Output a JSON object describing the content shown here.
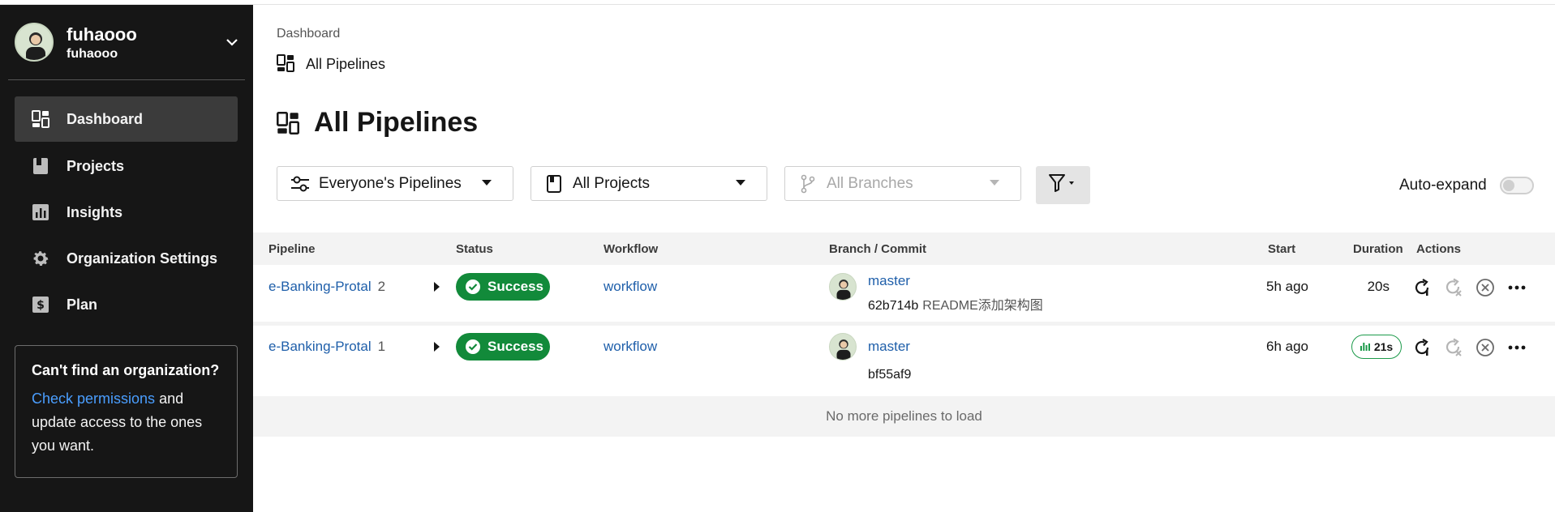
{
  "user": {
    "name": "fuhaooo",
    "org": "fuhaooo"
  },
  "nav": {
    "items": [
      {
        "label": "Dashboard",
        "icon": "dashboard-icon",
        "active": true
      },
      {
        "label": "Projects",
        "icon": "book-icon",
        "active": false
      },
      {
        "label": "Insights",
        "icon": "chart-icon",
        "active": false
      },
      {
        "label": "Organization Settings",
        "icon": "gear-icon",
        "active": false
      },
      {
        "label": "Plan",
        "icon": "dollar-icon",
        "active": false
      }
    ]
  },
  "orgbox": {
    "title": "Can't find an organization?",
    "link": "Check permissions",
    "text_after": " and update access to the ones you want."
  },
  "breadcrumb": {
    "parent": "Dashboard",
    "current": "All Pipelines"
  },
  "page_title": "All Pipelines",
  "filters": {
    "pipelines": "Everyone's Pipelines",
    "projects": "All Projects",
    "branches": "All Branches",
    "auto_expand": "Auto-expand"
  },
  "table": {
    "headers": {
      "pipeline": "Pipeline",
      "status": "Status",
      "workflow": "Workflow",
      "branch": "Branch / Commit",
      "start": "Start",
      "duration": "Duration",
      "actions": "Actions"
    },
    "rows": [
      {
        "pipeline": "e-Banking-Protal",
        "number": "2",
        "status": "Success",
        "workflow": "workflow",
        "branch": "master",
        "sha": "62b714b",
        "message": "README添加架构图",
        "start": "5h ago",
        "duration": "20s"
      },
      {
        "pipeline": "e-Banking-Protal",
        "number": "1",
        "status": "Success",
        "workflow": "workflow",
        "branch": "master",
        "sha": "bf55af9",
        "message": "",
        "start": "6h ago",
        "duration": "21s"
      }
    ],
    "footer": "No more pipelines to load"
  },
  "colors": {
    "sidebar_bg": "#161616",
    "success": "#128a3a",
    "link": "#1f5faa"
  }
}
